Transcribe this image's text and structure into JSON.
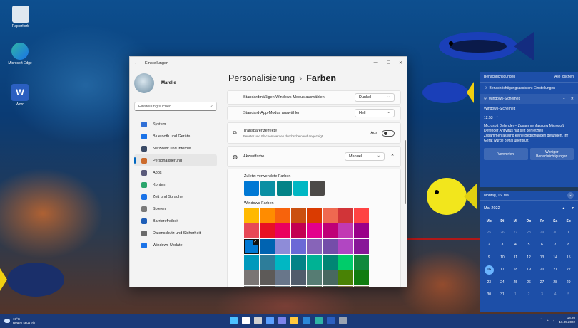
{
  "desktop": {
    "icons": [
      {
        "label": "Papierkorb"
      },
      {
        "label": "Microsoft Edge"
      },
      {
        "label": "Word"
      }
    ]
  },
  "settings": {
    "window_title": "Einstellungen",
    "user_name": "Marelle",
    "search_placeholder": "Einstellung suchen",
    "nav": [
      {
        "label": "System",
        "color": "#2f6fd6"
      },
      {
        "label": "Bluetooth und Geräte",
        "color": "#1a73e8"
      },
      {
        "label": "Netzwerk und Internet",
        "color": "#3a4a66"
      },
      {
        "label": "Personalisierung",
        "color": "#cc6b2c"
      },
      {
        "label": "Apps",
        "color": "#5a5a7a"
      },
      {
        "label": "Konten",
        "color": "#2aa56b"
      },
      {
        "label": "Zeit und Sprache",
        "color": "#1a73e8"
      },
      {
        "label": "Spielen",
        "color": "#7a7a7a"
      },
      {
        "label": "Barrierefreiheit",
        "color": "#1f5fb8"
      },
      {
        "label": "Datenschutz und Sicherheit",
        "color": "#6a6a6a"
      },
      {
        "label": "Windows Update",
        "color": "#1a73e8"
      }
    ],
    "active_nav": "Personalisierung",
    "breadcrumb_parent": "Personalisierung",
    "breadcrumb_separator": "›",
    "breadcrumb_current": "Farben",
    "windows_mode_label": "Standardmäßigen Windows-Modus auswählen",
    "windows_mode_value": "Dunkel",
    "app_mode_label": "Standard-App-Modus auswählen",
    "app_mode_value": "Hell",
    "transparency_label": "Transparenzeffekte",
    "transparency_desc": "Fenster und Flächen werden durchscheinend angezeigt",
    "transparency_state": "Aus",
    "accent_label": "Akzentfarbe",
    "accent_value": "Manuell",
    "recent_colors_label": "Zuletzt verwendete Farben",
    "recent_colors": [
      "#0078d4",
      "#0a8fa3",
      "#038387",
      "#00b7c3",
      "#4c4a48"
    ],
    "windows_colors_label": "Windows-Farben",
    "windows_colors": [
      "#ffb900",
      "#ff8c00",
      "#f7630c",
      "#ca5010",
      "#da3b01",
      "#ef6950",
      "#d13438",
      "#ff4343",
      "#e74856",
      "#e81123",
      "#ea005e",
      "#c30052",
      "#e3008c",
      "#bf0077",
      "#c239b3",
      "#9a0089",
      "#0078d4",
      "#0063b1",
      "#8e8cd8",
      "#6b69d6",
      "#8764b8",
      "#744da9",
      "#b146c2",
      "#881798",
      "#0099bc",
      "#2d7d9a",
      "#00b7c3",
      "#038387",
      "#00b294",
      "#018574",
      "#00cc6a",
      "#10893e",
      "#7a7574",
      "#5d5a58",
      "#68768a",
      "#515c6b",
      "#567c73",
      "#486860",
      "#498205",
      "#107c10",
      "#767676",
      "#4c4a48",
      "#69797e",
      "#4a5459",
      "#647c64",
      "#525e54",
      "#847545",
      "#7e735f"
    ],
    "selected_color_index": 16
  },
  "notifications": {
    "header": "Benachrichtigungen",
    "clear_all": "Alle löschen",
    "assistant_link": "Benachrichtigungsassistent-Einstellungen",
    "app_name": "Windows-Sicherheit",
    "source": "Windows-Sicherheit",
    "time": "12:53",
    "message": "Microsoft Defender – Zusammenfassung Microsoft Defender Antivirus hat seit der letzten Zusammenfassung keine Bedrohungen gefunden. Ihr Gerät wurde 3 Mal überprüft.",
    "button_dismiss": "Verwerfen",
    "button_less": "Weniger Benachrichtigungen"
  },
  "calendar": {
    "date_header": "Montag, 16. Mai",
    "month": "Mai 2022",
    "weekdays": [
      "Mo",
      "Di",
      "Mi",
      "Do",
      "Fr",
      "Sa",
      "So"
    ],
    "days": [
      {
        "d": "25",
        "m": true
      },
      {
        "d": "26",
        "m": true
      },
      {
        "d": "27",
        "m": true
      },
      {
        "d": "28",
        "m": true
      },
      {
        "d": "29",
        "m": true
      },
      {
        "d": "30",
        "m": true
      },
      {
        "d": "1",
        "m": false
      },
      {
        "d": "2",
        "m": false
      },
      {
        "d": "3",
        "m": false
      },
      {
        "d": "4",
        "m": false
      },
      {
        "d": "5",
        "m": false
      },
      {
        "d": "6",
        "m": false
      },
      {
        "d": "7",
        "m": false
      },
      {
        "d": "8",
        "m": false
      },
      {
        "d": "9",
        "m": false
      },
      {
        "d": "10",
        "m": false
      },
      {
        "d": "11",
        "m": false
      },
      {
        "d": "12",
        "m": false
      },
      {
        "d": "13",
        "m": false
      },
      {
        "d": "14",
        "m": false
      },
      {
        "d": "15",
        "m": false
      },
      {
        "d": "16",
        "m": false,
        "today": true
      },
      {
        "d": "17",
        "m": false
      },
      {
        "d": "18",
        "m": false
      },
      {
        "d": "19",
        "m": false
      },
      {
        "d": "20",
        "m": false
      },
      {
        "d": "21",
        "m": false
      },
      {
        "d": "22",
        "m": false
      },
      {
        "d": "23",
        "m": false
      },
      {
        "d": "24",
        "m": false
      },
      {
        "d": "25",
        "m": false
      },
      {
        "d": "26",
        "m": false
      },
      {
        "d": "27",
        "m": false
      },
      {
        "d": "28",
        "m": false
      },
      {
        "d": "29",
        "m": false
      },
      {
        "d": "30",
        "m": false
      },
      {
        "d": "31",
        "m": false
      },
      {
        "d": "1",
        "m": true
      },
      {
        "d": "2",
        "m": true
      },
      {
        "d": "3",
        "m": true
      },
      {
        "d": "4",
        "m": true
      },
      {
        "d": "5",
        "m": true
      }
    ]
  },
  "taskbar": {
    "weather_temp": "19°C",
    "weather_desc": "Regen setzt ein",
    "time": "18:20",
    "date": "16.05.2022",
    "apps": [
      {
        "icon": "start-icon",
        "color": "#4cc2ff"
      },
      {
        "icon": "search-icon",
        "color": "#ffffff"
      },
      {
        "icon": "taskview-icon",
        "color": "#d0d0d0"
      },
      {
        "icon": "widgets-icon",
        "color": "#5aa0ff"
      },
      {
        "icon": "chat-icon",
        "color": "#7b83eb"
      },
      {
        "icon": "explorer-icon",
        "color": "#ffc83d"
      },
      {
        "icon": "store-icon",
        "color": "#2b88d8"
      },
      {
        "icon": "edge-icon",
        "color": "#2fb5a5"
      },
      {
        "icon": "word-icon",
        "color": "#2b5fc0"
      },
      {
        "icon": "settings-icon",
        "color": "#9aa4b2"
      }
    ]
  }
}
